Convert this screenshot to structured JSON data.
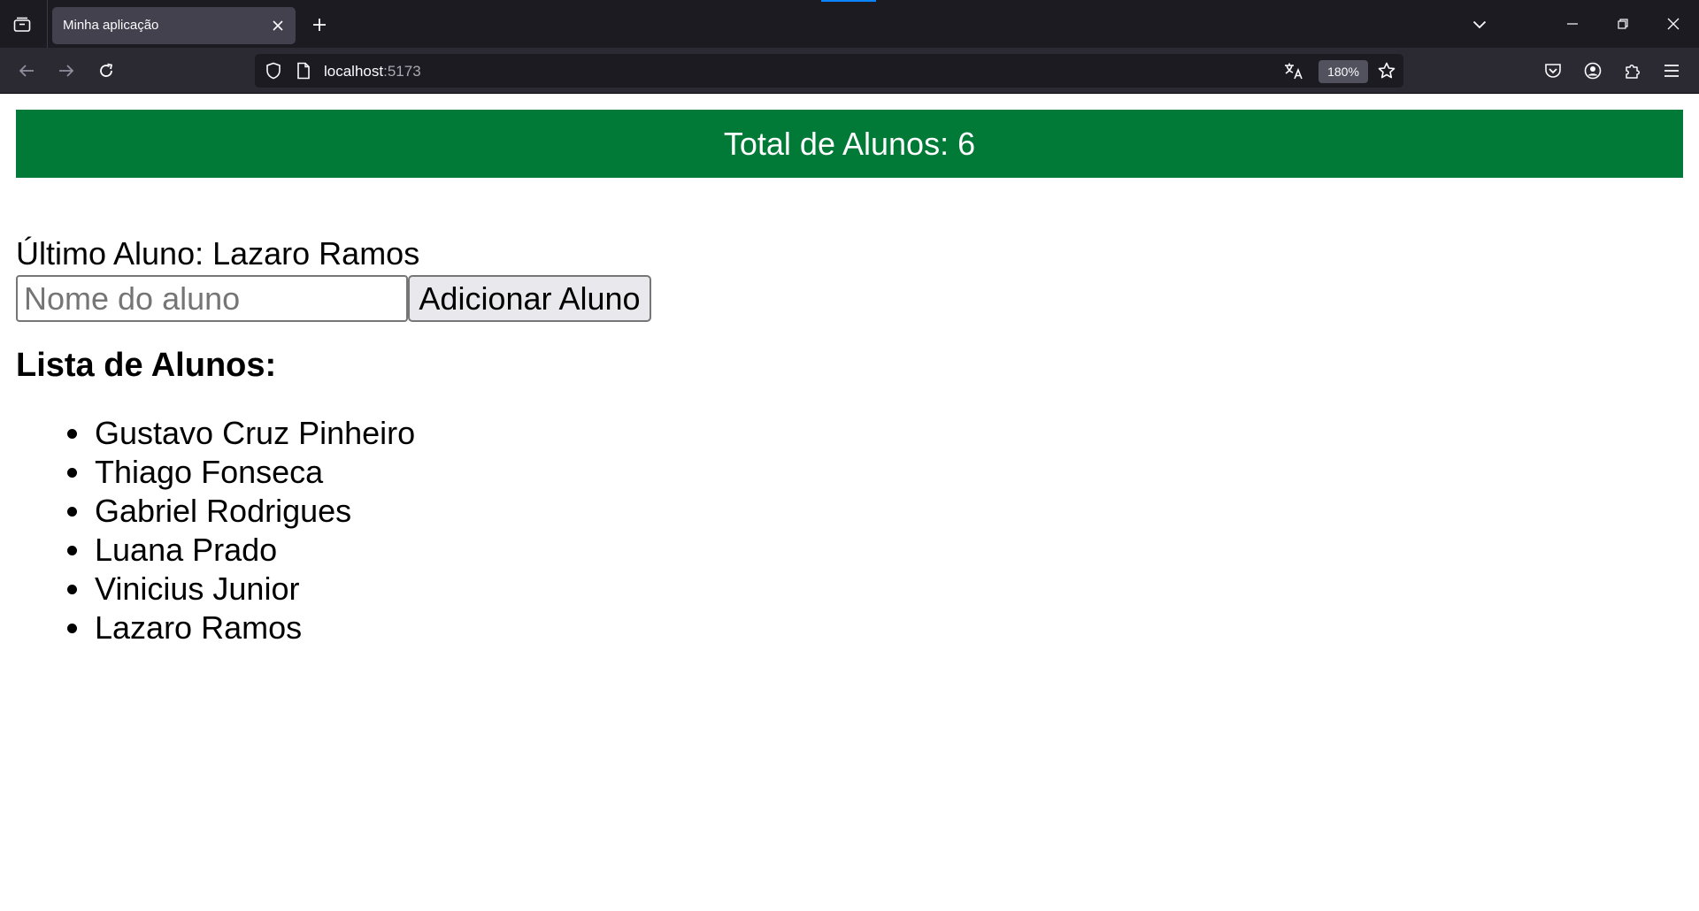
{
  "browser": {
    "tab": {
      "title": "Minha aplicação"
    },
    "url": {
      "host": "localhost",
      "port": ":5173"
    },
    "zoom": "180%",
    "icons": {
      "tab_list": "tab-list-icon",
      "close_tab": "close-icon",
      "new_tab": "plus-icon",
      "tabs_dropdown": "chevron-down-icon",
      "minimize": "minimize-icon",
      "restore": "restore-icon",
      "close_window": "close-icon",
      "back": "arrow-left-icon",
      "forward": "arrow-right-icon",
      "reload": "reload-icon",
      "tracking_protection": "shield-icon",
      "page_info": "page-icon",
      "translate": "translate-icon",
      "bookmark": "star-icon",
      "pocket": "pocket-icon",
      "account": "account-icon",
      "extensions": "puzzle-icon",
      "menu": "hamburger-menu-icon"
    }
  },
  "page": {
    "banner": "Total de Alunos: 6",
    "last_student": "Último Aluno: Lazaro Ramos",
    "input_placeholder": "Nome do aluno",
    "add_button": "Adicionar Aluno",
    "list_heading": "Lista de Alunos:",
    "students": [
      "Gustavo Cruz Pinheiro",
      "Thiago Fonseca",
      "Gabriel Rodrigues",
      "Luana Prado",
      "Vinicius Junior",
      "Lazaro Ramos"
    ]
  },
  "colors": {
    "banner_bg": "#007a36",
    "chrome_dark": "#1c1b22",
    "toolbar": "#2b2a33"
  }
}
